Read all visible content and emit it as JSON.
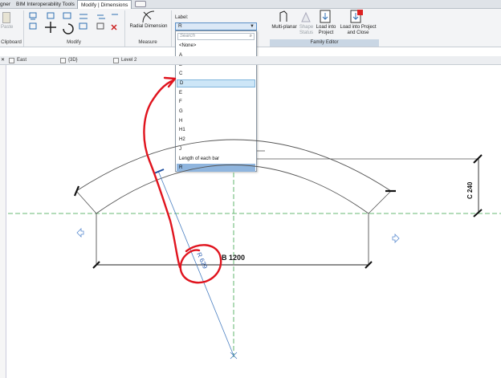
{
  "tabs": [
    "gner",
    "BIM Interoperability Tools",
    "Modify | Dimensions"
  ],
  "ribbon": {
    "paste_label": "Paste",
    "panels": [
      "Clipboard",
      "Modify",
      "Measure",
      "Family Editor"
    ],
    "radial_dimension": "Radial Dimension",
    "label_title": "Label:",
    "multi_planar": "Multi-planar",
    "shape_status": "Shape Status",
    "load_into_project": "Load into Project",
    "load_into_project_close": "Load into Project and Close"
  },
  "view_tabs": [
    "East",
    "{3D}",
    "Level 2"
  ],
  "dropdown": {
    "value": "R",
    "search_placeholder": "Search",
    "items": [
      "<None>",
      "A",
      "B",
      "C",
      "D",
      "E",
      "F",
      "G",
      "H",
      "H1",
      "H2",
      "J",
      "Length of each bar",
      "R"
    ],
    "highlighted": "D",
    "selected": "R"
  },
  "drawing": {
    "dim_b": "B 1200",
    "dim_c": "C 240",
    "dim_r": "R 629"
  },
  "colors": {
    "ribbon_bg": "#f3f4f6",
    "accent_blue": "#4a7fc1",
    "annotation_red": "#e0141e",
    "ref_plane_green": "#3aa24a"
  }
}
